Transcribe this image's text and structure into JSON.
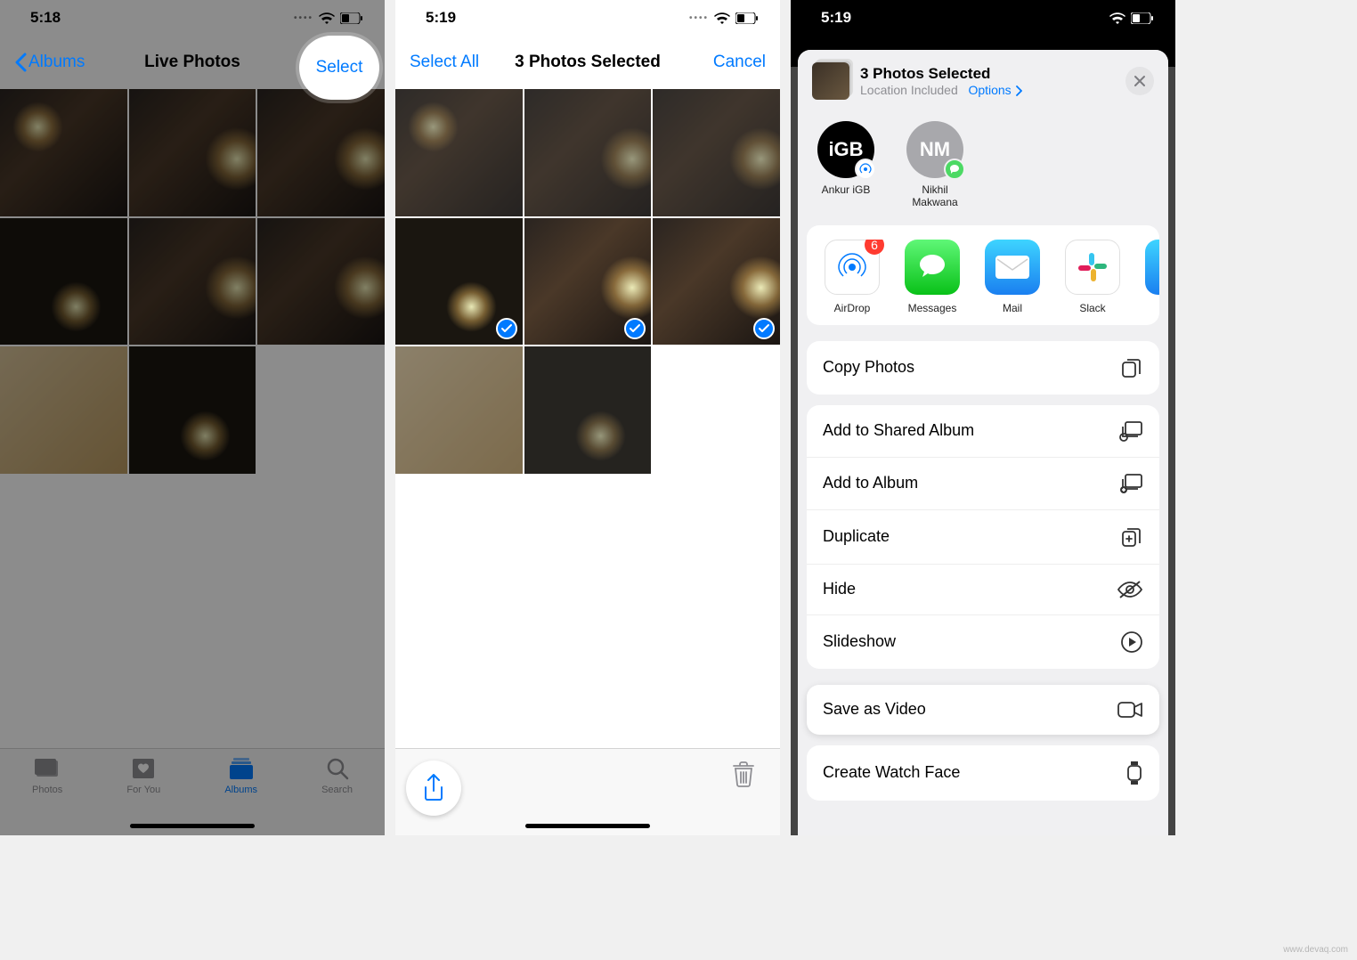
{
  "screen1": {
    "time": "5:18",
    "back_label": "Albums",
    "title": "Live Photos",
    "select_label": "Select",
    "tabs": {
      "photos": "Photos",
      "for_you": "For You",
      "albums": "Albums",
      "search": "Search"
    }
  },
  "screen2": {
    "time": "5:19",
    "select_all": "Select All",
    "title": "3 Photos Selected",
    "cancel": "Cancel"
  },
  "screen3": {
    "time": "5:19",
    "sheet_title": "3 Photos Selected",
    "location_text": "Location Included",
    "options_label": "Options",
    "contacts": [
      {
        "initials": "iGB",
        "name": "Ankur iGB",
        "badge": "airdrop"
      },
      {
        "initials": "NM",
        "name": "Nikhil Makwana",
        "badge": "msg"
      }
    ],
    "apps": {
      "airdrop": "AirDrop",
      "airdrop_badge": "6",
      "messages": "Messages",
      "mail": "Mail",
      "slack": "Slack"
    },
    "actions": {
      "copy": "Copy Photos",
      "shared_album": "Add to Shared Album",
      "add_album": "Add to Album",
      "duplicate": "Duplicate",
      "hide": "Hide",
      "slideshow": "Slideshow",
      "save_video": "Save as Video",
      "watch_face": "Create Watch Face"
    }
  },
  "watermark": "www.devaq.com"
}
